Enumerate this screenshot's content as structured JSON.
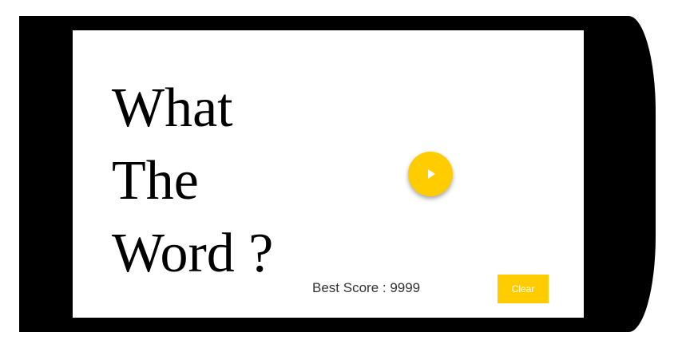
{
  "app": {
    "title_lines": [
      "What",
      "The",
      "Word ?"
    ]
  },
  "controls": {
    "play_icon": "play-icon",
    "clear_label": "Clear"
  },
  "score": {
    "label": "Best Score : 9999"
  },
  "colors": {
    "accent": "#ffcc00",
    "frame": "#000000",
    "screen": "#ffffff"
  }
}
